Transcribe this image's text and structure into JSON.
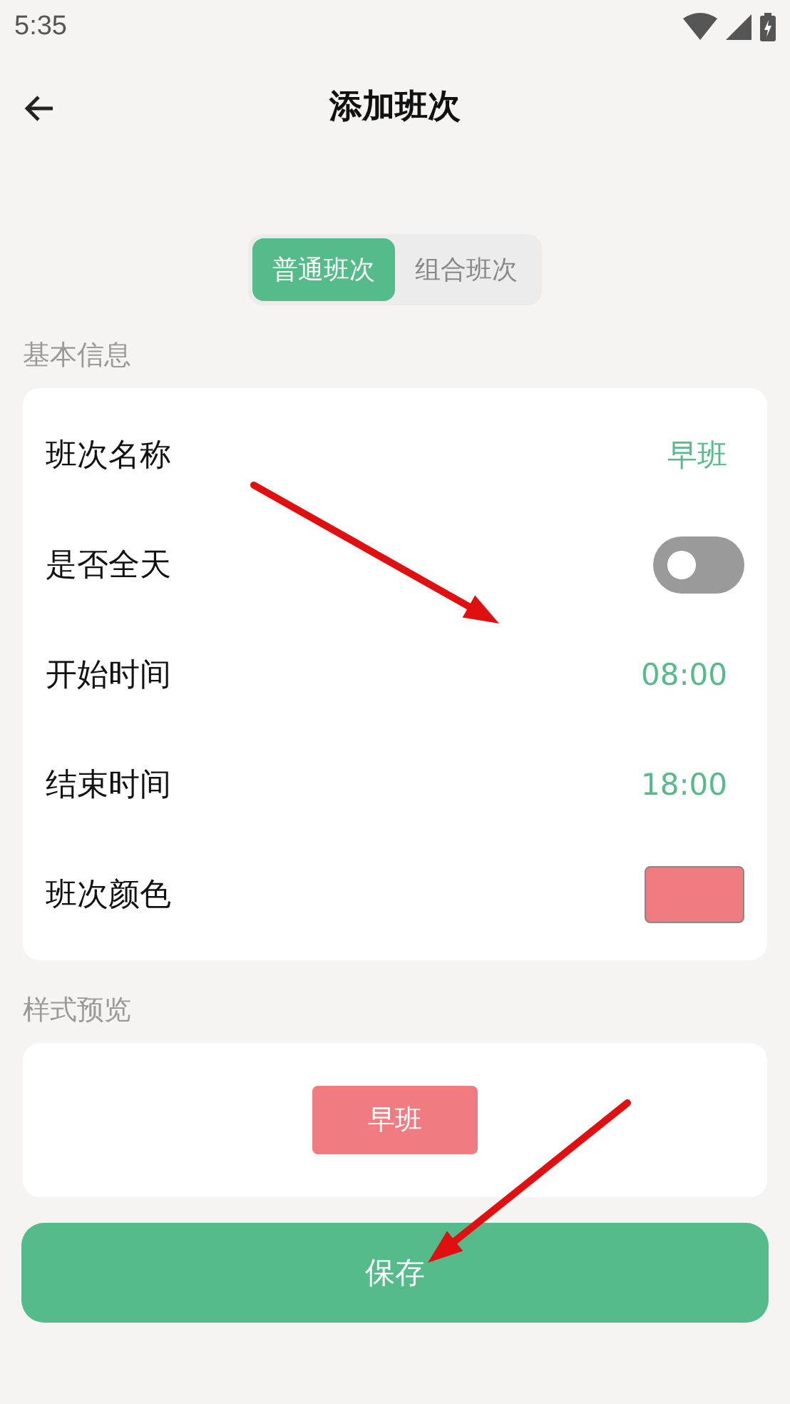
{
  "status_bar": {
    "time": "5:35"
  },
  "header": {
    "title": "添加班次"
  },
  "tabs": [
    {
      "label": "普通班次",
      "selected": true
    },
    {
      "label": "组合班次",
      "selected": false
    }
  ],
  "basic_info": {
    "title": "基本信息",
    "rows": [
      {
        "kind": "text",
        "label": "班次名称",
        "value": "早班"
      },
      {
        "kind": "toggle",
        "label": "是否全天",
        "on": false
      },
      {
        "kind": "text",
        "label": "开始时间",
        "value": "08:00"
      },
      {
        "kind": "text",
        "label": "结束时间",
        "value": "18:00"
      },
      {
        "kind": "color",
        "label": "班次颜色",
        "color": "#f07b80"
      }
    ]
  },
  "preview": {
    "title": "样式预览",
    "chip": {
      "label": "早班",
      "color": "#f07b80"
    }
  },
  "save_button": {
    "label": "保存"
  }
}
